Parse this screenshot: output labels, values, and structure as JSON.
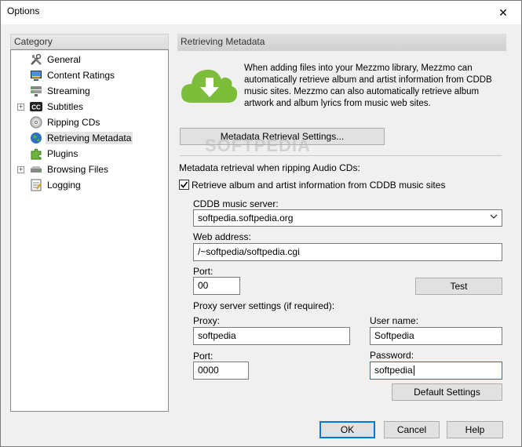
{
  "window": {
    "title": "Options"
  },
  "category": {
    "header": "Category",
    "items": [
      {
        "label": "General",
        "icon": "tools-icon",
        "expandable": false
      },
      {
        "label": "Content Ratings",
        "icon": "ratings-icon",
        "expandable": false
      },
      {
        "label": "Streaming",
        "icon": "streaming-icon",
        "expandable": false
      },
      {
        "label": "Subtitles",
        "icon": "cc-icon",
        "expandable": true
      },
      {
        "label": "Ripping CDs",
        "icon": "cd-icon",
        "expandable": false
      },
      {
        "label": "Retrieving Metadata",
        "icon": "globe-icon",
        "expandable": false,
        "selected": true
      },
      {
        "label": "Plugins",
        "icon": "puzzle-icon",
        "expandable": false
      },
      {
        "label": "Browsing Files",
        "icon": "drive-icon",
        "expandable": true
      },
      {
        "label": "Logging",
        "icon": "log-icon",
        "expandable": false
      }
    ]
  },
  "main": {
    "header": "Retrieving Metadata",
    "description": "When adding files into your Mezzmo library, Mezzmo can automatically retrieve album and artist information from CDDB music sites.  Mezzmo can also automatically retrieve album artwork and album lyrics from music web sites.",
    "settings_button": "Metadata Retrieval Settings...",
    "ripping_label": "Metadata retrieval when ripping Audio CDs:",
    "checkbox_label": "Retrieve album and artist information from CDDB music sites",
    "checkbox_checked": true,
    "cddb_label": "CDDB music server:",
    "cddb_value": "softpedia.softpedia.org",
    "web_label": "Web address:",
    "web_value": "/~softpedia/softpedia.cgi",
    "port_label": "Port:",
    "port_value": "00",
    "test_button": "Test",
    "proxy_section_label": "Proxy server settings (if required):",
    "proxy_label": "Proxy:",
    "proxy_value": "softpedia",
    "username_label": "User name:",
    "username_value": "Softpedia",
    "proxy_port_label": "Port:",
    "proxy_port_value": "0000",
    "password_label": "Password:",
    "password_value": "softpedia",
    "default_button": "Default Settings"
  },
  "footer": {
    "ok": "OK",
    "cancel": "Cancel",
    "help": "Help"
  },
  "watermark": "SOFTPEDIA",
  "colors": {
    "accent": "#0078d7",
    "cloud": "#7cbd3a"
  }
}
